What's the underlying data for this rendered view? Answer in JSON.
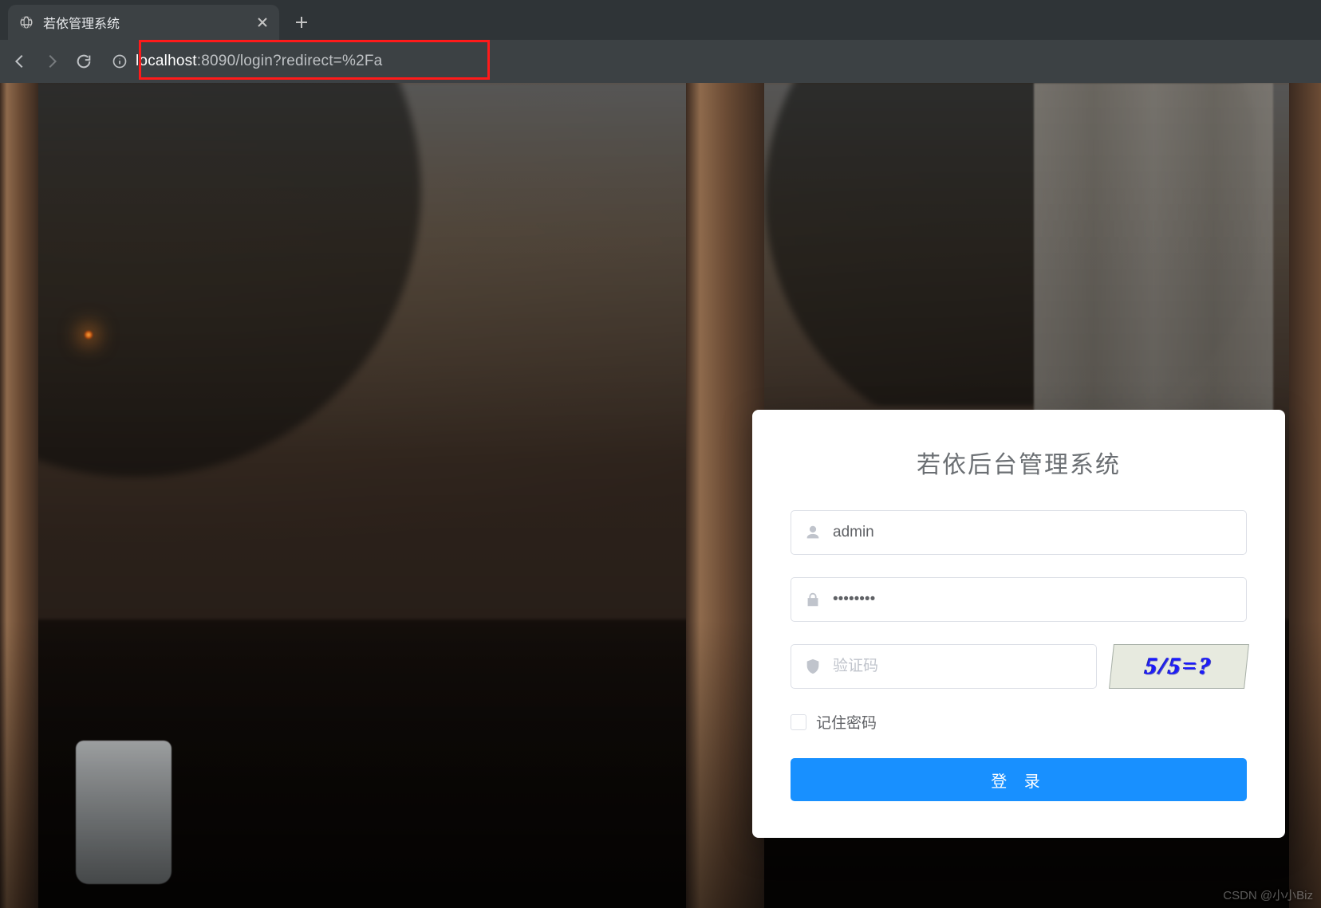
{
  "browser": {
    "tab_title": "若依管理系统",
    "url_host": "localhost",
    "url_rest": ":8090/login?redirect=%2Fa"
  },
  "login": {
    "title": "若依后台管理系统",
    "username_value": "admin",
    "password_value": "********",
    "captcha_placeholder": "验证码",
    "captcha_text": "5/5=?",
    "remember_label": "记住密码",
    "submit_label": "登 录"
  },
  "watermark": "CSDN @小小Biz"
}
